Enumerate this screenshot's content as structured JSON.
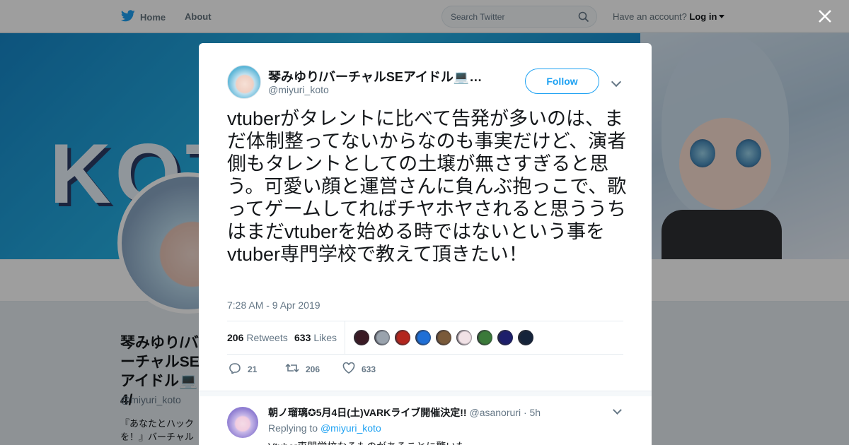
{
  "nav": {
    "home_label": "Home",
    "about_label": "About",
    "search_placeholder": "Search Twitter",
    "account_prompt": "Have an account?",
    "login_label": "Log in",
    "brand_color": "#1da1f2"
  },
  "banner": {
    "logo_text": "KOT"
  },
  "profile": {
    "name": "琴みゆり/バーチャルSEアイドル💻4/",
    "handle": "@miyuri_koto",
    "bio": "『あなたとハック を！』バーチャル"
  },
  "tweet": {
    "author_name": "琴みゆり/バーチャルSEアイドル💻…",
    "author_handle": "@miyuri_koto",
    "follow_label": "Follow",
    "text": "vtuberがタレントに比べて告発が多いのは、まだ体制整ってないからなのも事実だけど、演者側もタレントとしての土壌が無さすぎると思う。可愛い顔と運営さんに負んぶ抱っこで、歌ってゲームしてればチヤホヤされると思ううちはまだvtuberを始める時ではないという事をvtuber専門学校で教えて頂きたい！",
    "timestamp": "7:28 AM - 9 Apr 2019",
    "retweets_count": "206",
    "retweets_label": "Retweets",
    "likes_count": "633",
    "likes_label": "Likes",
    "replies_action_count": "21",
    "retweets_action_count": "206",
    "likes_action_count": "633",
    "liker_colors": [
      "#3a1a24",
      "#9aa3ad",
      "#b3261e",
      "#1f6fd6",
      "#7a5a3a",
      "#f1e2e6",
      "#3b7a3a",
      "#1d1f6b",
      "#15233a"
    ]
  },
  "reply": {
    "author_name": "朝ノ瑠璃✪5月4日(土)VARKライブ開催決定!!",
    "author_handle": "@asanoruri",
    "time": "· 5h",
    "replying_to_label": "Replying to",
    "replying_to_handle": "@miyuri_koto",
    "text": "Vtuber専門学校なるものがあることに驚いた"
  }
}
